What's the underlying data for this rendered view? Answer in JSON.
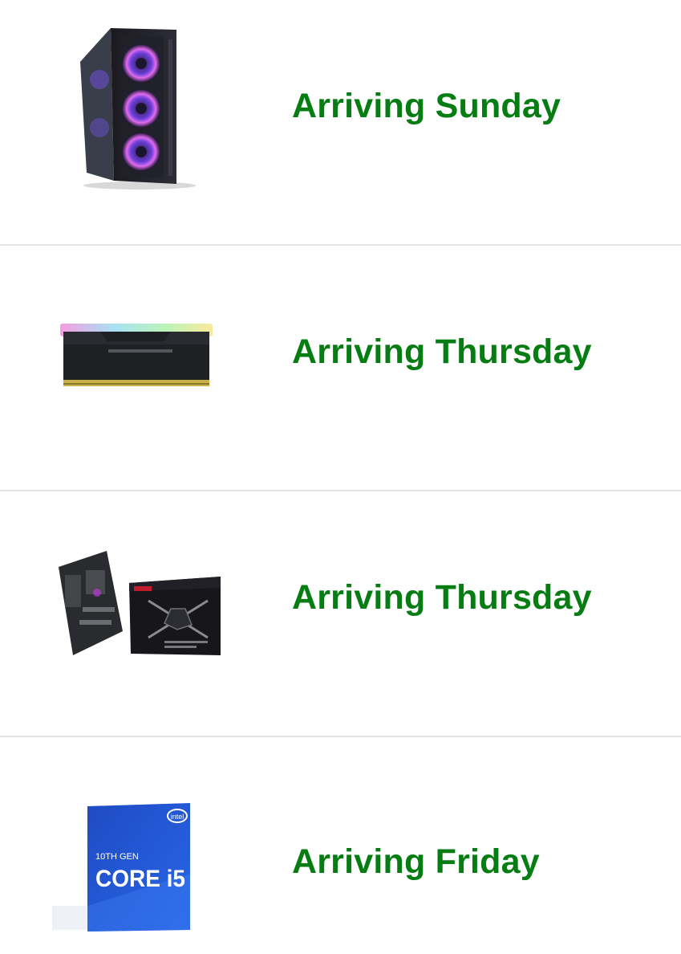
{
  "accent_color": "#067d13",
  "orders": [
    {
      "status": "Arriving Sunday",
      "product_icon": "pc-case-icon"
    },
    {
      "status": "Arriving Thursday",
      "product_icon": "ram-module-icon"
    },
    {
      "status": "Arriving Thursday",
      "product_icon": "motherboard-icon"
    },
    {
      "status": "Arriving Friday",
      "product_icon": "cpu-box-icon",
      "product_box_text": [
        "10TH GEN",
        "CORE i5",
        "intel"
      ]
    }
  ]
}
